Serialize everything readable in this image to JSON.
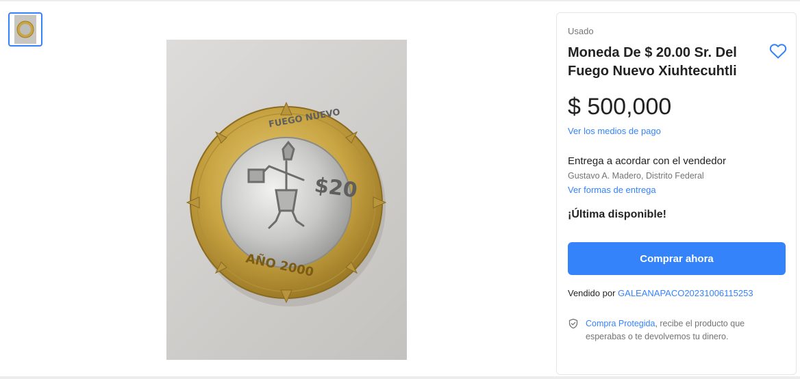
{
  "item": {
    "condition": "Usado",
    "title": "Moneda De $ 20.00 Sr. Del Fuego Nuevo Xiuhtecuhtli",
    "price": "$ 500,000",
    "payment_link": "Ver los medios de pago"
  },
  "delivery": {
    "title": "Entrega a acordar con el vendedor",
    "location": "Gustavo A. Madero, Distrito Federal",
    "link": "Ver formas de entrega"
  },
  "stock_label": "¡Última disponible!",
  "buy_label": "Comprar ahora",
  "seller": {
    "prefix": "Vendido por",
    "name": "GALEANAPACO20231006115253"
  },
  "protection": {
    "link": "Compra Protegida",
    "text": ", recibe el producto que esperabas o te devolvemos tu dinero."
  },
  "coin_text": {
    "top": "FUEGO NUEVO",
    "value": "$20",
    "year": "AÑO 2000"
  },
  "colors": {
    "accent": "#3483fa",
    "gold": "#c9a543",
    "silver": "#c8c8c6"
  },
  "icons": [
    "heart-icon",
    "shield-icon"
  ]
}
